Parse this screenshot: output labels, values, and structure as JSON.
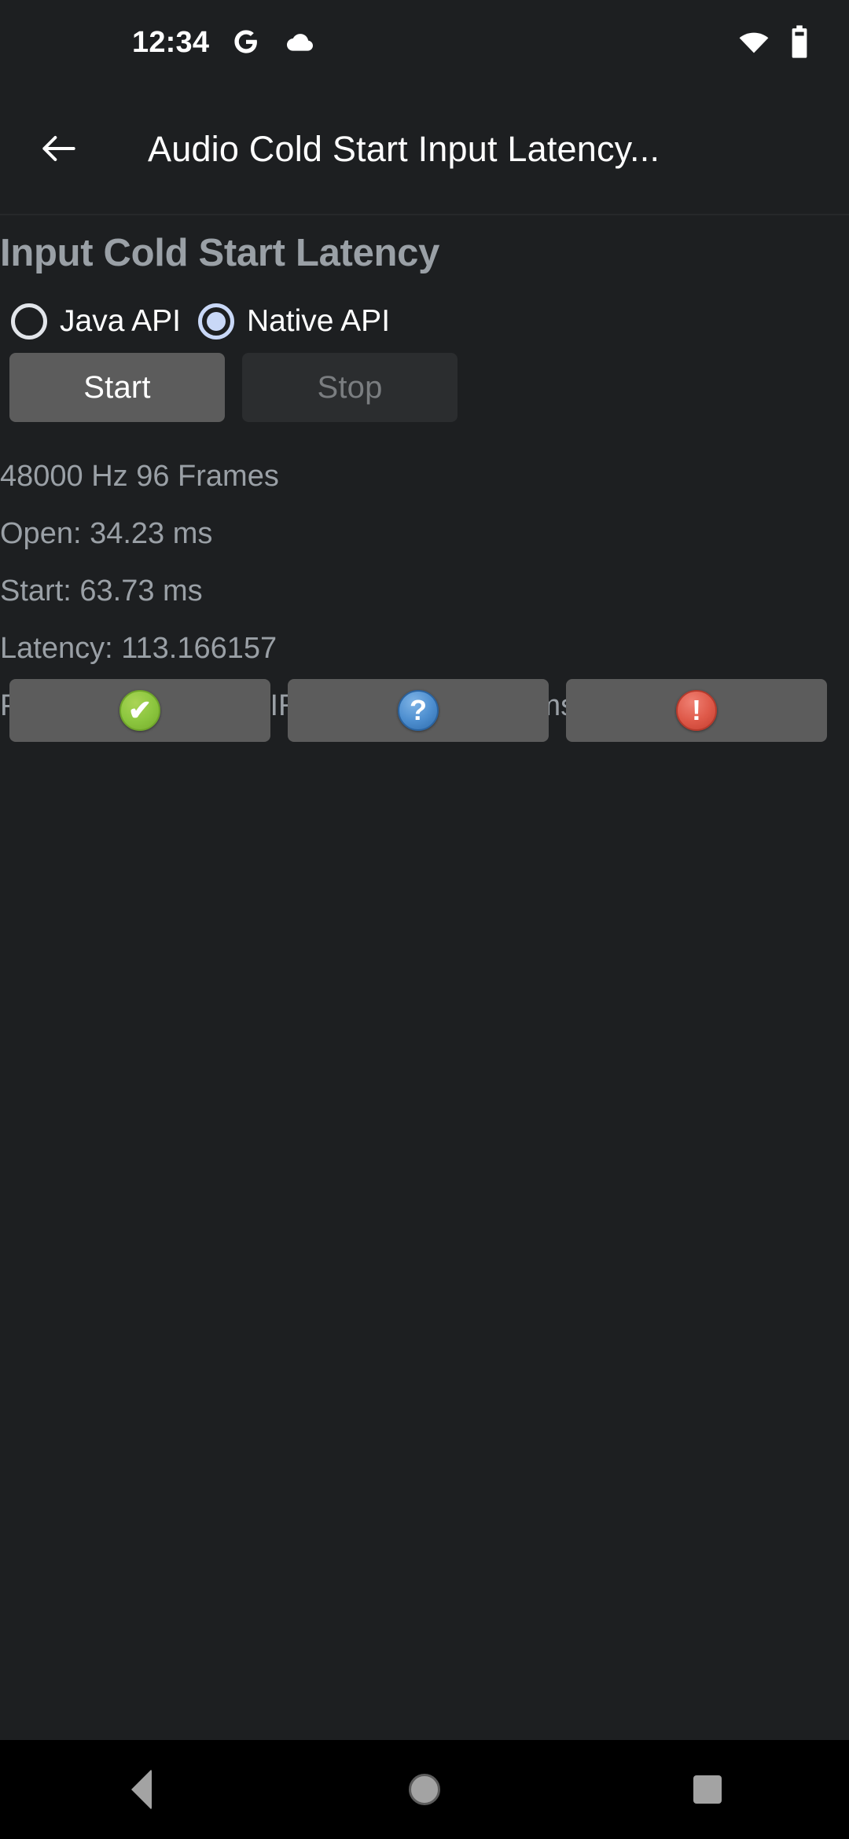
{
  "status_bar": {
    "clock": "12:34",
    "icons_left": [
      "google-g-icon",
      "cloud-icon"
    ],
    "icons_right": [
      "wifi-icon",
      "battery-icon"
    ]
  },
  "app_bar": {
    "back_icon": "arrow-back-icon",
    "title": "Audio Cold Start Input Latency..."
  },
  "content": {
    "section_title": "Input Cold Start Latency",
    "radio_group": {
      "options": [
        {
          "label": "Java API",
          "selected": false
        },
        {
          "label": "Native API",
          "selected": true
        }
      ]
    },
    "actions": [
      {
        "label": "Start",
        "enabled": true
      },
      {
        "label": "Stop",
        "enabled": false
      }
    ],
    "results": [
      "48000 Hz 96 Frames",
      "Open: 34.23 ms",
      "Start: 63.73 ms",
      "Latency: 113.166157",
      "PASS. Meets REQUIRED latency of 500ms"
    ],
    "verdict_buttons": [
      {
        "icon": "check-circle-icon",
        "glyph": "✔",
        "kind": "pass"
      },
      {
        "icon": "question-circle-icon",
        "glyph": "?",
        "kind": "info"
      },
      {
        "icon": "exclamation-circle-icon",
        "glyph": "!",
        "kind": "fail"
      }
    ]
  },
  "nav_bar": {
    "buttons": [
      "nav-back-icon",
      "nav-home-icon",
      "nav-recents-icon"
    ]
  },
  "colors": {
    "background": "#1d1f21",
    "nav_background": "#000000",
    "secondary_text": "#9aa0a6",
    "primary_text": "#ffffff",
    "radio_selected": "#c9d8f7",
    "button_enabled": "#5c5c5c",
    "button_disabled": "#2b2d2f",
    "pass_green": "#8cc63f",
    "info_blue": "#4e8fd0",
    "fail_red": "#df5a4a"
  }
}
